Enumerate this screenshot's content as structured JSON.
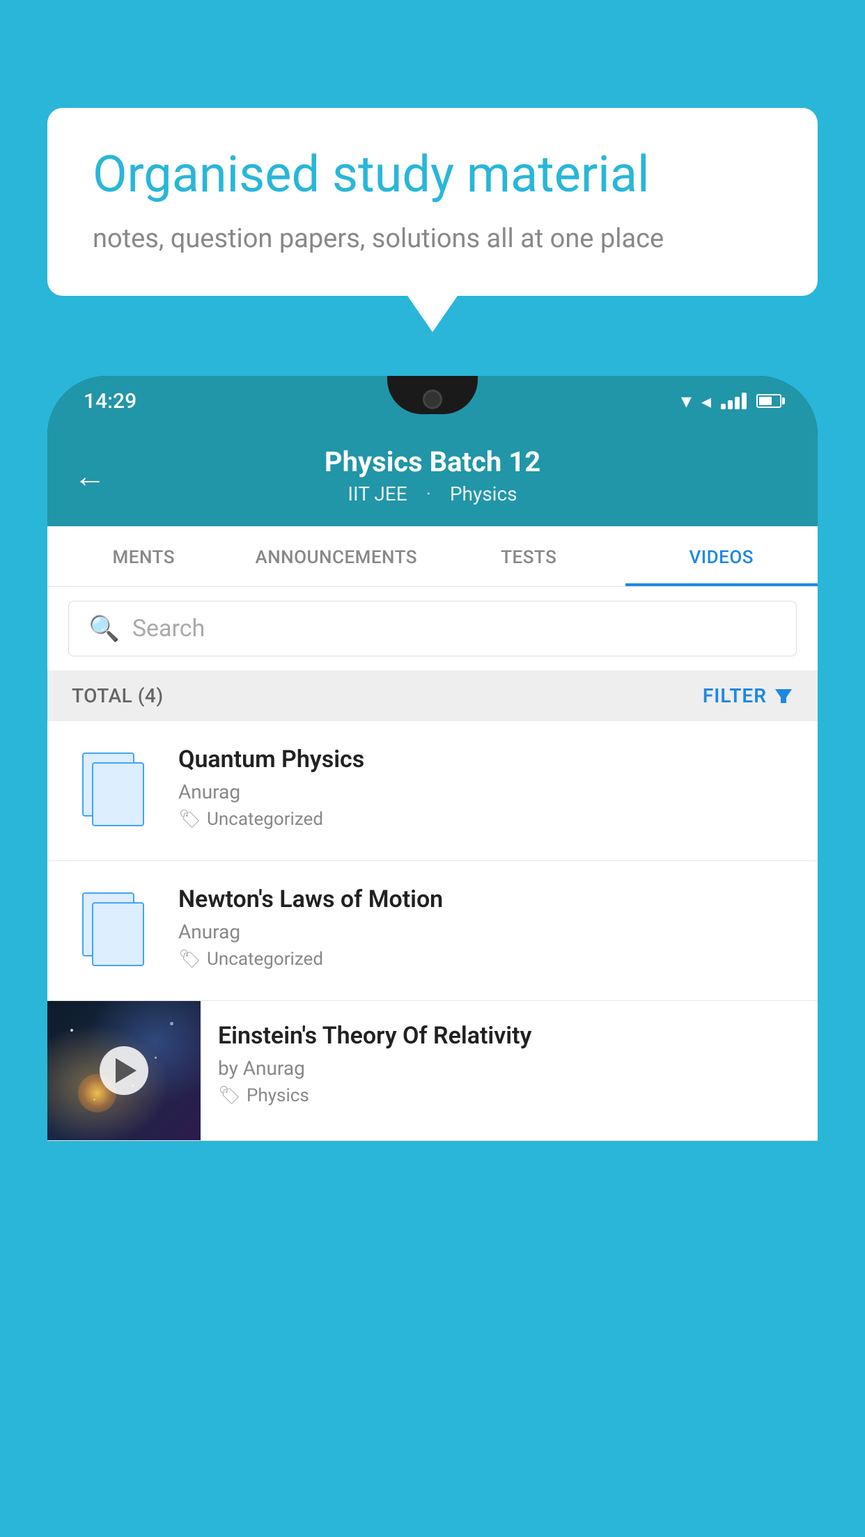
{
  "background_color": "#29b6d8",
  "speech_bubble": {
    "title": "Organised study material",
    "subtitle": "notes, question papers, solutions all at one place"
  },
  "phone": {
    "status_bar": {
      "time": "14:29"
    },
    "app_header": {
      "title": "Physics Batch 12",
      "subtitle_parts": [
        "IIT JEE",
        "Physics"
      ],
      "back_label": "←"
    },
    "tabs": [
      {
        "label": "MENTS",
        "active": false
      },
      {
        "label": "ANNOUNCEMENTS",
        "active": false
      },
      {
        "label": "TESTS",
        "active": false
      },
      {
        "label": "VIDEOS",
        "active": true
      }
    ],
    "search": {
      "placeholder": "Search"
    },
    "filter_bar": {
      "total_label": "TOTAL (4)",
      "filter_label": "FILTER"
    },
    "video_items": [
      {
        "id": 1,
        "title": "Quantum Physics",
        "author": "Anurag",
        "tag": "Uncategorized",
        "type": "document"
      },
      {
        "id": 2,
        "title": "Newton's Laws of Motion",
        "author": "Anurag",
        "tag": "Uncategorized",
        "type": "document"
      },
      {
        "id": 3,
        "title": "Einstein's Theory Of Relativity",
        "author": "by Anurag",
        "tag": "Physics",
        "type": "video"
      }
    ]
  }
}
